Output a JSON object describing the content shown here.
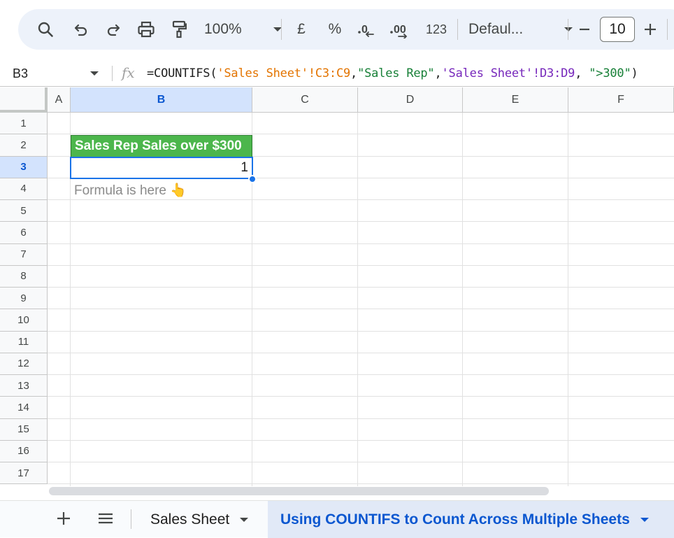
{
  "toolbar": {
    "zoom": "100%",
    "currency": "£",
    "percent": "%",
    "number_format": "123",
    "font": "Defaul...",
    "font_size": "10",
    "decrease_label": "–",
    "increase_label": "+"
  },
  "formula_bar": {
    "cell_ref": "B3",
    "fx": "fx",
    "formula_parts": [
      {
        "text": "=COUNTIFS(",
        "color": "plain"
      },
      {
        "text": "'Sales Sheet'!C3:C9",
        "color": "orange"
      },
      {
        "text": ",",
        "color": "plain"
      },
      {
        "text": "\"Sales Rep\"",
        "color": "green"
      },
      {
        "text": ",",
        "color": "plain"
      },
      {
        "text": "'Sales Sheet'!D3:D9",
        "color": "purple"
      },
      {
        "text": ", ",
        "color": "plain"
      },
      {
        "text": "\">300\"",
        "color": "green"
      },
      {
        "text": ")",
        "color": "plain"
      }
    ]
  },
  "grid": {
    "columns": [
      "A",
      "B",
      "C",
      "D",
      "E",
      "F"
    ],
    "selected_column": "B",
    "rows": [
      "1",
      "2",
      "3",
      "4",
      "5",
      "6",
      "7",
      "8",
      "9",
      "10",
      "11",
      "12",
      "13",
      "14",
      "15",
      "16",
      "17"
    ],
    "selected_row": "3",
    "cells": {
      "B2": "Sales Rep Sales over $300",
      "B3": "1",
      "B4": "Formula is here 👆"
    },
    "header_fill": "#4cb64c"
  },
  "sheet_tabs": {
    "tabs": [
      {
        "label": "Sales Sheet",
        "active": false
      },
      {
        "label": "Using COUNTIFS to Count Across Multiple Sheets",
        "active": true
      }
    ]
  },
  "colors": {
    "accent": "#1a73e8",
    "toolbar_bg": "#edf2fa"
  }
}
